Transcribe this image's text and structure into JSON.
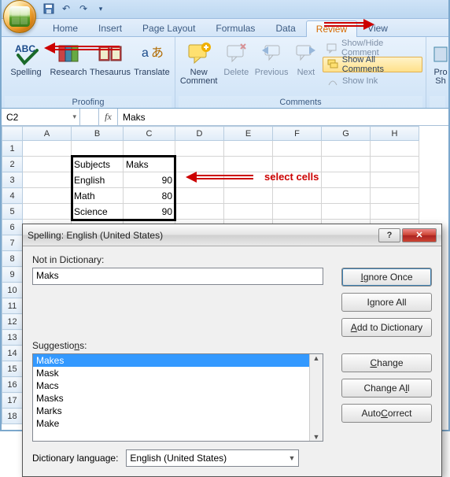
{
  "qat": {
    "save": "💾",
    "undo": "↶",
    "redo": "↷",
    "more": "▾"
  },
  "tabs": {
    "home": "Home",
    "insert": "Insert",
    "pagelayout": "Page Layout",
    "formulas": "Formulas",
    "data": "Data",
    "review": "Review",
    "view": "View"
  },
  "ribbon": {
    "proofing": {
      "label": "Proofing",
      "spelling": "Spelling",
      "research": "Research",
      "thesaurus": "Thesaurus",
      "translate": "Translate"
    },
    "comments": {
      "label": "Comments",
      "newcomment_l1": "New",
      "newcomment_l2": "Comment",
      "delete": "Delete",
      "previous": "Previous",
      "next": "Next",
      "showhide": "Show/Hide Comment",
      "showall": "Show All Comments",
      "showink": "Show Ink"
    },
    "changes": {
      "protect_l1": "Pro",
      "protect_l2": "Sh"
    }
  },
  "namebox": "C2",
  "fx_label": "fx",
  "formula_value": "Maks",
  "columns": [
    "A",
    "B",
    "C",
    "D",
    "E",
    "F",
    "G",
    "H"
  ],
  "rows": [
    "1",
    "2",
    "3",
    "4",
    "5",
    "6",
    "7",
    "8",
    "9",
    "10",
    "11",
    "12",
    "13",
    "14",
    "15",
    "16",
    "17",
    "18"
  ],
  "cells": {
    "B2": "Subjects",
    "C2": "Maks",
    "B3": "English",
    "C3": "90",
    "B4": "Math",
    "C4": "80",
    "B5": "Science",
    "C5": "90"
  },
  "annotation": {
    "select_cells": "select cells"
  },
  "dialog": {
    "title": "Spelling: English (United States)",
    "not_in_dict_label": "Not in Dictionary:",
    "not_in_dict_value": "Maks",
    "ignore_once": "Ignore Once",
    "ignore_all": "Ignore All",
    "add_to_dict": "Add to Dictionary",
    "suggestions_label": "Suggestions:",
    "suggestions": [
      "Makes",
      "Mask",
      "Macs",
      "Masks",
      "Marks",
      "Make"
    ],
    "change": "Change",
    "change_all": "Change All",
    "autocorrect": "AutoCorrect",
    "dict_lang_label": "Dictionary language:",
    "dict_lang_value": "English (United States)"
  }
}
